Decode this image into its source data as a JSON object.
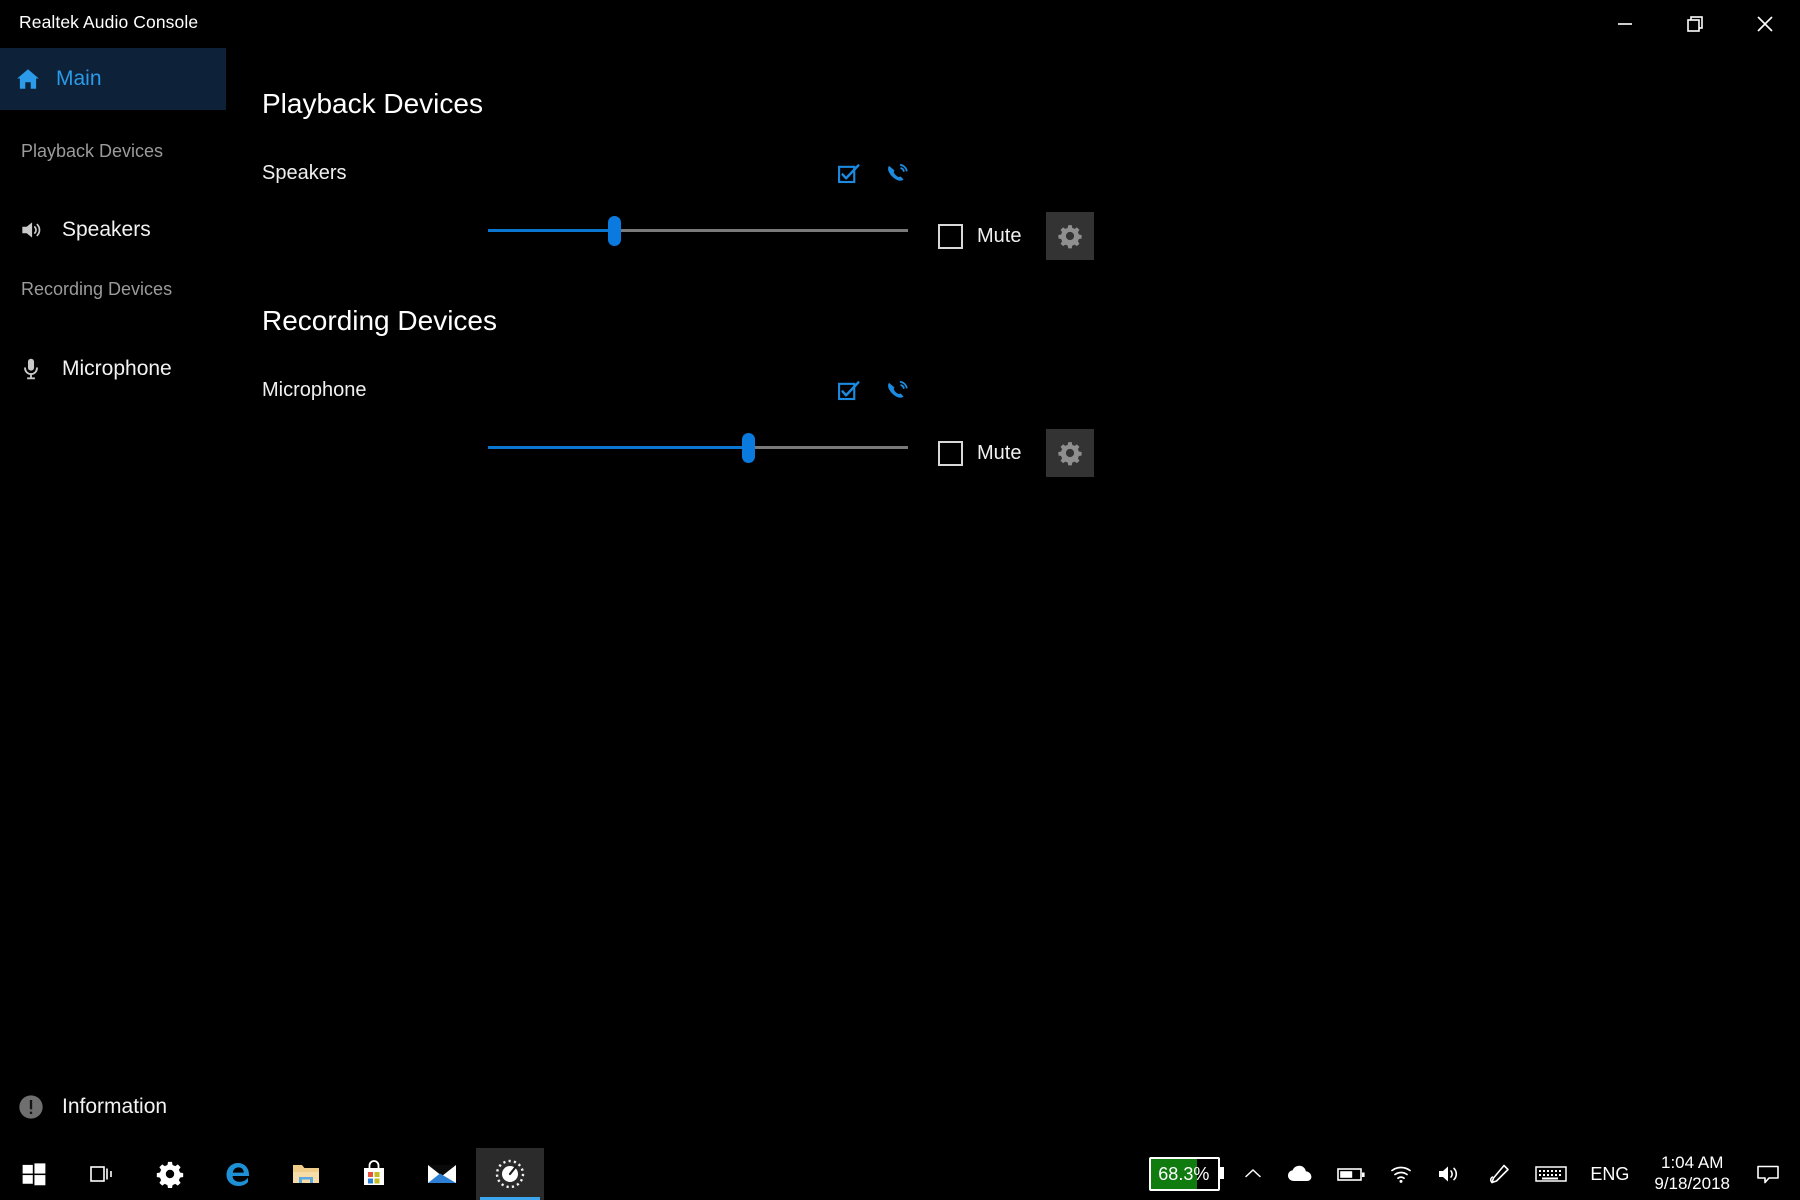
{
  "window": {
    "title": "Realtek Audio Console",
    "controls": [
      {
        "name": "minimize",
        "label": "Minimize"
      },
      {
        "name": "restore",
        "label": "Restore"
      },
      {
        "name": "close",
        "label": "Close"
      }
    ]
  },
  "sidebar": {
    "main": {
      "label": "Main",
      "icon": "home-icon",
      "selected": true,
      "highlight_color": "#0d2239",
      "text_color": "#2b9ae8"
    },
    "sections": [
      {
        "label": "Playback Devices"
      },
      {
        "label": "Recording Devices"
      }
    ],
    "items": [
      {
        "label": "Speakers",
        "icon": "speaker-icon"
      },
      {
        "label": "Microphone",
        "icon": "microphone-icon"
      }
    ],
    "information": {
      "label": "Information",
      "icon": "info-icon"
    }
  },
  "main": {
    "playback": {
      "heading": "Playback Devices",
      "device": {
        "name": "Speakers",
        "default_device_icon": "checkbox-check-icon",
        "default_communication_icon": "phone-call-icon",
        "volume_percent": 30,
        "mute_label": "Mute",
        "muted": false,
        "settings_icon": "gear-icon"
      }
    },
    "recording": {
      "heading": "Recording Devices",
      "device": {
        "name": "Microphone",
        "default_device_icon": "checkbox-check-icon",
        "default_communication_icon": "phone-call-icon",
        "volume_percent": 62,
        "mute_label": "Mute",
        "muted": false,
        "settings_icon": "gear-icon"
      }
    }
  },
  "taskbar": {
    "items": [
      {
        "name": "start-button",
        "icon": "windows-logo-icon",
        "active": false
      },
      {
        "name": "task-view-button",
        "icon": "task-view-icon",
        "active": false
      },
      {
        "name": "settings-app",
        "icon": "gear-icon",
        "active": false
      },
      {
        "name": "edge-browser",
        "icon": "edge-icon",
        "active": false
      },
      {
        "name": "file-explorer",
        "icon": "folder-icon",
        "active": false
      },
      {
        "name": "microsoft-store",
        "icon": "store-bag-icon",
        "active": false
      },
      {
        "name": "mail-app",
        "icon": "mail-envelope-icon",
        "active": false
      },
      {
        "name": "realtek-audio-console",
        "icon": "realtek-gauge-icon",
        "active": true
      }
    ],
    "tray": {
      "battery_percent_label": "68.3%",
      "battery_fill_percent": 68.3,
      "battery_color": "#107c10",
      "icons": [
        {
          "name": "show-hidden-icons",
          "icon": "chevron-up-icon"
        },
        {
          "name": "onedrive",
          "icon": "cloud-icon"
        },
        {
          "name": "battery",
          "icon": "battery-icon"
        },
        {
          "name": "network",
          "icon": "wifi-icon"
        },
        {
          "name": "volume",
          "icon": "speaker-icon"
        },
        {
          "name": "pen-workspace",
          "icon": "pen-icon"
        },
        {
          "name": "touch-keyboard",
          "icon": "keyboard-icon"
        }
      ],
      "language": "ENG",
      "time": "1:04 AM",
      "date": "9/18/2018",
      "action_center_icon": "action-center-icon"
    }
  }
}
